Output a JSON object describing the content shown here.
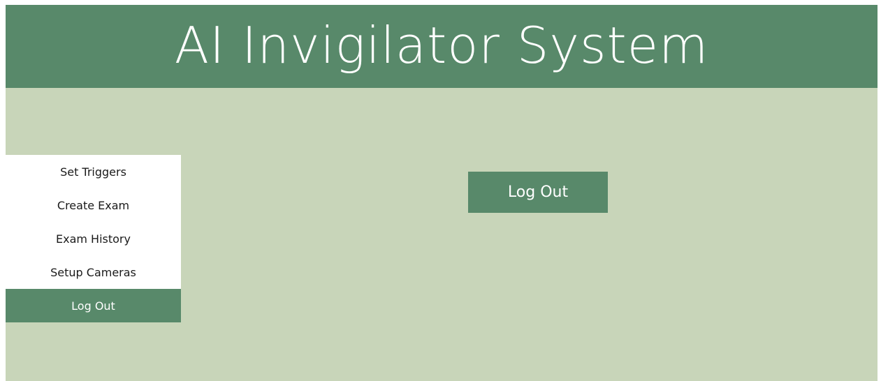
{
  "header": {
    "title": "AI Invigilator System"
  },
  "sidebar": {
    "items": [
      {
        "label": "Set Triggers",
        "active": false
      },
      {
        "label": "Create Exam",
        "active": false
      },
      {
        "label": "Exam History",
        "active": false
      },
      {
        "label": "Setup Cameras",
        "active": false
      },
      {
        "label": "Log Out",
        "active": true
      }
    ]
  },
  "main": {
    "logout_button_label": "Log Out"
  },
  "colors": {
    "primary": "#58896a",
    "background": "#c8d5b9",
    "sidebar_bg": "#ffffff",
    "text_dark": "#1a1a1a",
    "text_light": "#ffffff"
  }
}
